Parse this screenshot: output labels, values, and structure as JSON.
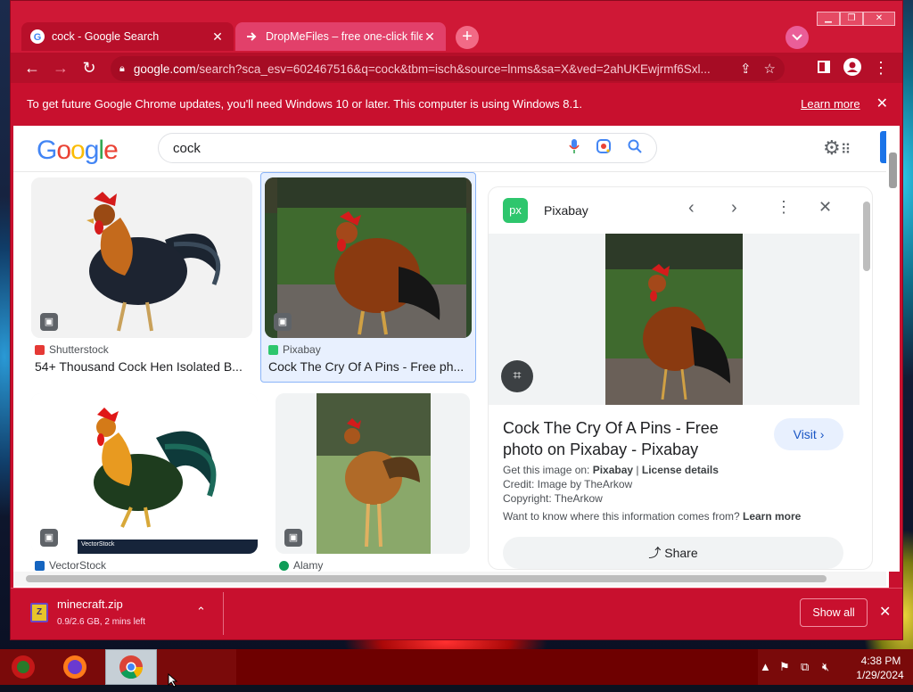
{
  "browser": {
    "tabs": [
      {
        "title": "cock - Google Search",
        "favicon": "google-g-icon",
        "active": true
      },
      {
        "title": "DropMeFiles – free one-click file",
        "favicon": "dropmefiles-arrow-icon",
        "active": false
      }
    ],
    "new_tab_symbol": "+",
    "url": "google.com/search?sca_esv=602467516&q=cock&tbm=isch&source=lnms&sa=X&ved=2ahUKEwjrmf6Sxl...",
    "url_host": "google.com",
    "url_path": "/search?sca_esv=602467516&q=cock&tbm=isch&source=lnms&sa=X&ved=2ahUKEwjrmf6Sxl..."
  },
  "infobar": {
    "message": "To get future Google Chrome updates, you'll need Windows 10 or later. This computer is using Windows 8.1.",
    "learn_more": "Learn more"
  },
  "google": {
    "logo": [
      "G",
      "o",
      "o",
      "g",
      "l",
      "e"
    ],
    "logo_colors": [
      "#4285f4",
      "#ea4335",
      "#fbbc05",
      "#4285f4",
      "#34a853",
      "#ea4335"
    ],
    "query": "cock"
  },
  "results": [
    {
      "source": "Shutterstock",
      "source_color": "#e53935",
      "title": "54+ Thousand Cock Hen Isolated B..."
    },
    {
      "source": "Pixabay",
      "source_color": "#2ec66d",
      "title": "Cock The Cry Of A Pins - Free ph..."
    },
    {
      "source": "VectorStock",
      "source_color": "#1565c0",
      "title": ""
    },
    {
      "source": "Alamy",
      "source_color": "#0f9d58",
      "title": ""
    }
  ],
  "image_label": "VectorStock",
  "panel": {
    "source_icon_text": "px",
    "source_name": "Pixabay",
    "title": "Cock The Cry Of A Pins - Free photo on Pixabay - Pixabay",
    "visit": "Visit",
    "get_image_prefix": "Get this image on: ",
    "get_image_site": "Pixabay",
    "license_sep": " | ",
    "license": "License details",
    "credit": "Credit: Image by TheArkow",
    "copyright": "Copyright: TheArkow",
    "info_question": "Want to know where this information comes from? ",
    "info_learn_more": "Learn more",
    "share": "Share"
  },
  "download": {
    "filename": "minecraft.zip",
    "status": "0.9/2.6 GB, 2 mins left",
    "show_all": "Show all"
  },
  "taskbar": {
    "time": "4:38 PM",
    "date": "1/29/2024"
  }
}
